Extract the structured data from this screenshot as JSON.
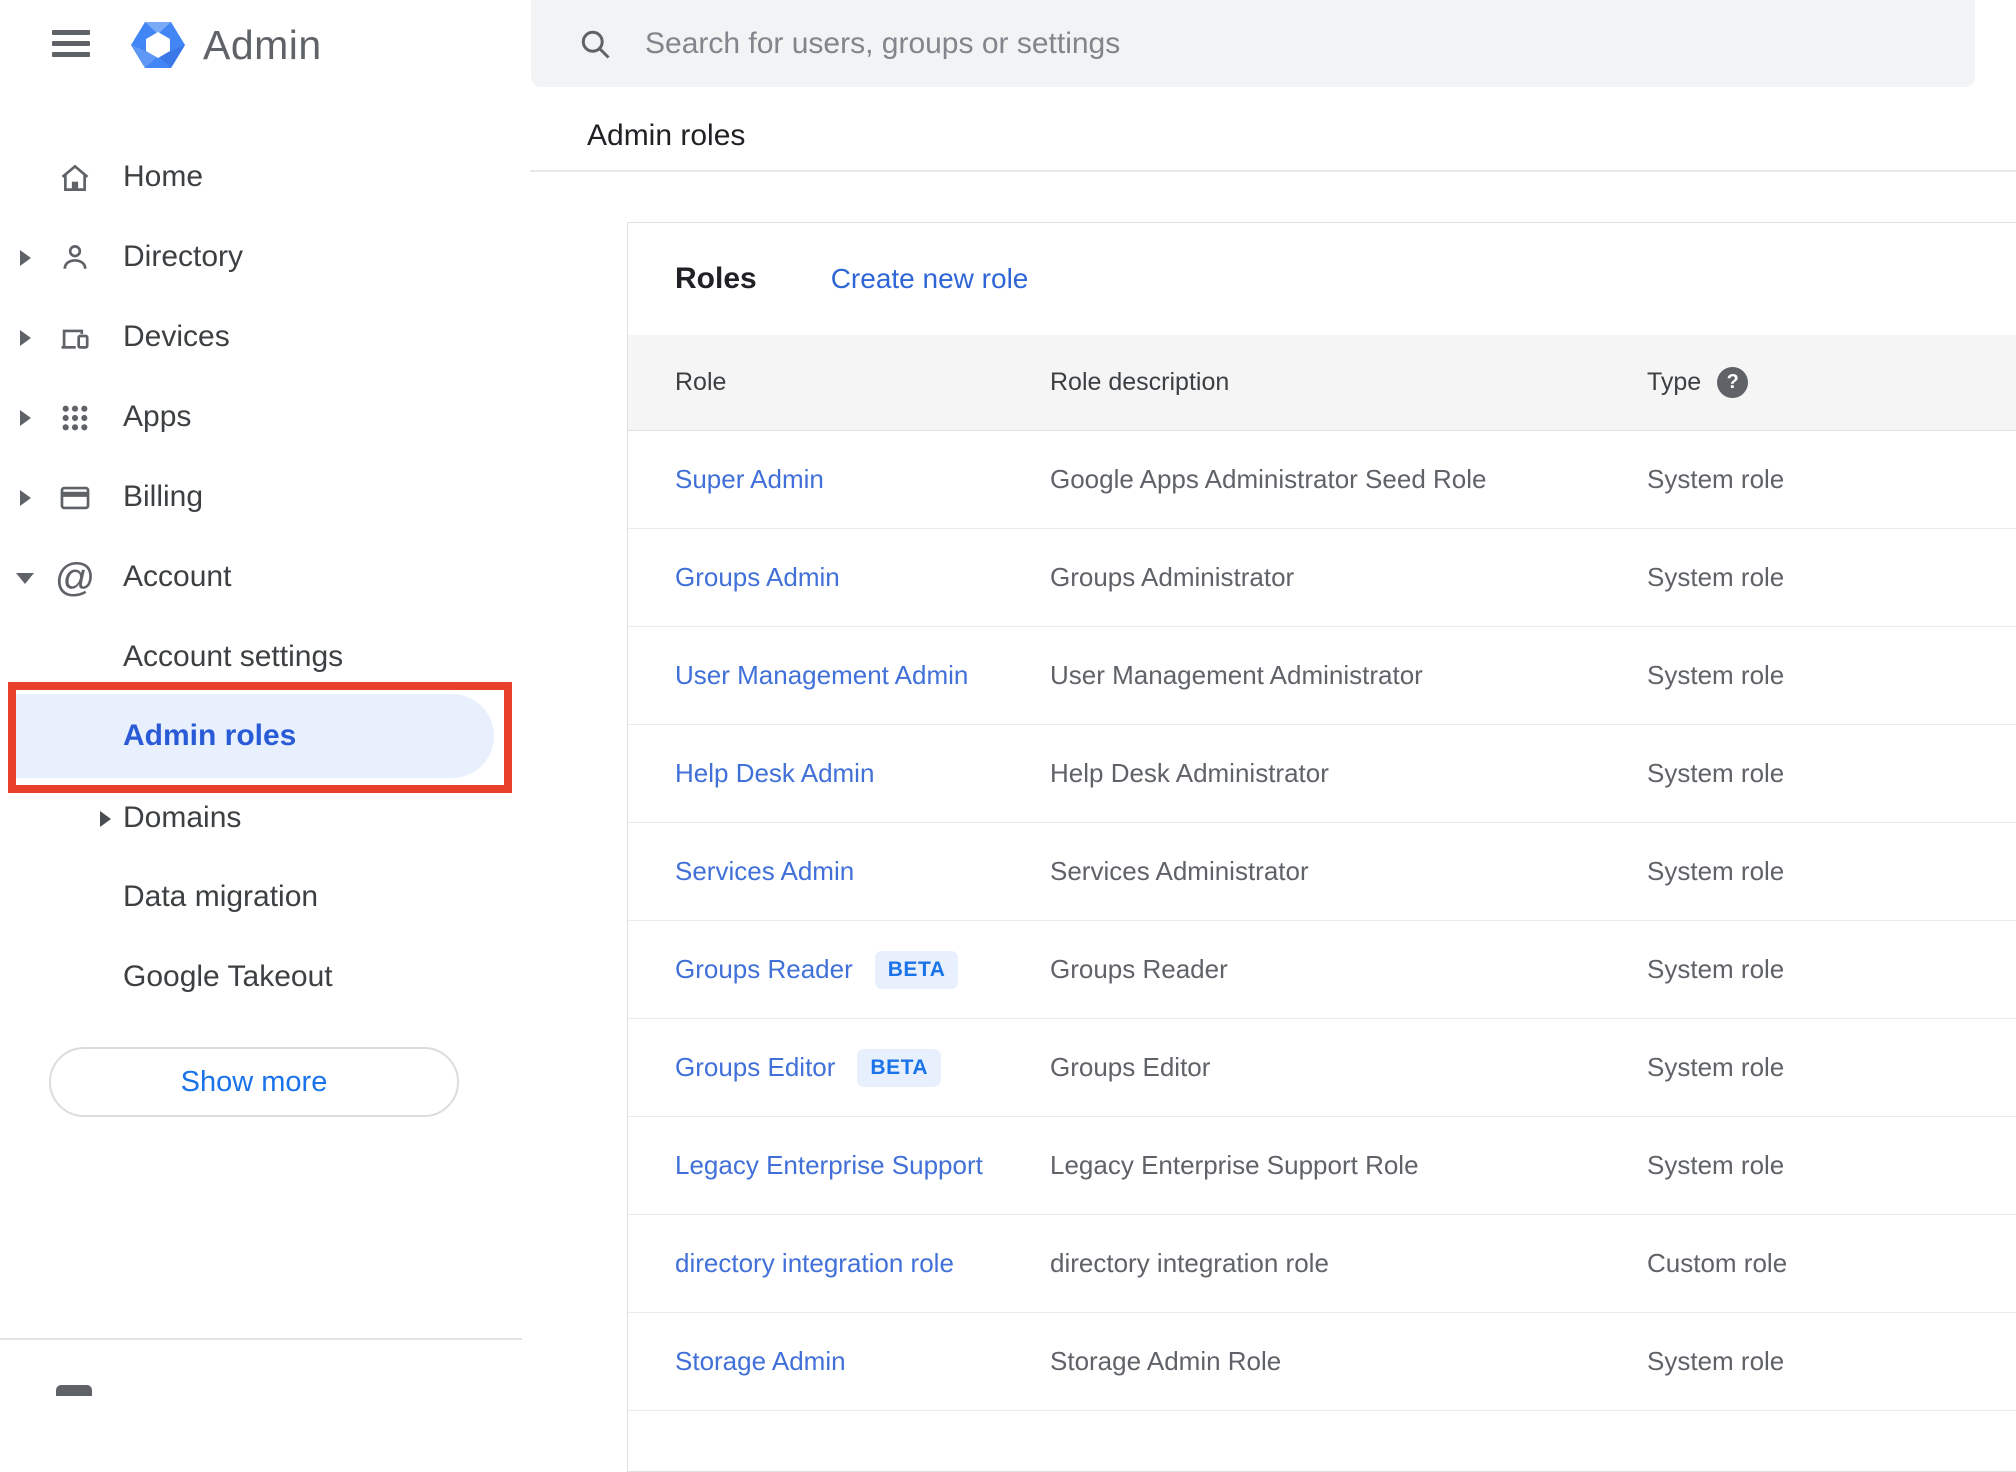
{
  "app": {
    "title": "Admin"
  },
  "search": {
    "placeholder": "Search for users, groups or settings"
  },
  "breadcrumb": "Admin roles",
  "sidebar": {
    "items": [
      {
        "label": "Home"
      },
      {
        "label": "Directory"
      },
      {
        "label": "Devices"
      },
      {
        "label": "Apps"
      },
      {
        "label": "Billing"
      },
      {
        "label": "Account"
      }
    ],
    "account_children": [
      {
        "label": "Account settings"
      },
      {
        "label": "Admin roles",
        "selected": true,
        "annotated": true
      },
      {
        "label": "Domains"
      },
      {
        "label": "Data migration"
      },
      {
        "label": "Google Takeout"
      }
    ],
    "show_more_label": "Show more"
  },
  "main": {
    "title": "Roles",
    "create_link": "Create new role",
    "table": {
      "columns": {
        "role": "Role",
        "description": "Role description",
        "type": "Type"
      },
      "help_icon": "?",
      "rows": [
        {
          "role": "Super Admin",
          "description": "Google Apps Administrator Seed Role",
          "type": "System role"
        },
        {
          "role": "Groups Admin",
          "description": "Groups Administrator",
          "type": "System role"
        },
        {
          "role": "User Management Admin",
          "description": "User Management Administrator",
          "type": "System role"
        },
        {
          "role": "Help Desk Admin",
          "description": "Help Desk Administrator",
          "type": "System role"
        },
        {
          "role": "Services Admin",
          "description": "Services Administrator",
          "type": "System role"
        },
        {
          "role": "Groups Reader",
          "badge": "BETA",
          "description": "Groups Reader",
          "type": "System role"
        },
        {
          "role": "Groups Editor",
          "badge": "BETA",
          "description": "Groups Editor",
          "type": "System role"
        },
        {
          "role": "Legacy Enterprise Support",
          "description": "Legacy Enterprise Support Role",
          "type": "System role"
        },
        {
          "role": "directory integration role",
          "description": "directory integration role",
          "type": "Custom role"
        },
        {
          "role": "Storage Admin",
          "description": "Storage Admin Role",
          "type": "System role"
        }
      ]
    }
  },
  "colors": {
    "annotation_red": "#e8402a",
    "selected_item_bg": "#e8f0fe",
    "selected_item_text": "#2a5bd7",
    "row_link_blue": "#4170d8",
    "action_blue": "#1a73e8",
    "beta_bg": "#e8f0fe",
    "beta_text": "#1a73e8",
    "logo_blue": "#4285f4",
    "search_bg": "#f1f3f4",
    "table_header_bg": "#f5f5f6"
  }
}
